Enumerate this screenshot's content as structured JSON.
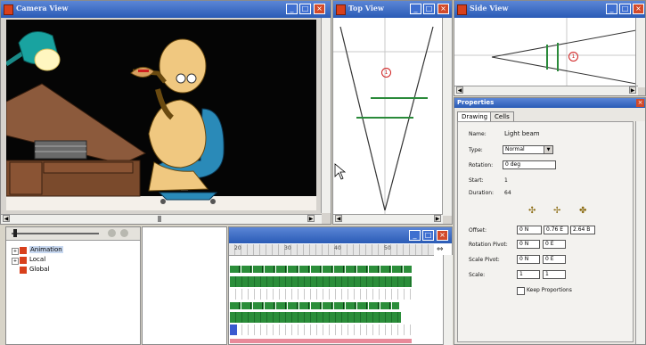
{
  "camera_view": {
    "title": "Camera View"
  },
  "top_view": {
    "title": "Top View",
    "marker": "1"
  },
  "side_view": {
    "title": "Side View",
    "marker": "1"
  },
  "properties": {
    "title": "Properties",
    "tabs": [
      "Drawing",
      "Cells"
    ],
    "active_tab": "Drawing",
    "fields": {
      "name_label": "Name:",
      "name_value": "Light beam",
      "type_label": "Type:",
      "type_value": "Normal",
      "rotation_label": "Rotation:",
      "rotation_value": "0 deg",
      "start_label": "Start:",
      "start_value": "1",
      "duration_label": "Duration:",
      "duration_value": "64",
      "offset_label": "Offset:",
      "offset_x": "0 N",
      "offset_y": "0.76 E",
      "offset_z": "2.64 B",
      "rotation_pivot_label": "Rotation Pivot:",
      "rotation_pivot_a": "0 N",
      "rotation_pivot_b": "0 E",
      "scale_pivot_label": "Scale Pivot:",
      "scale_pivot_a": "0 N",
      "scale_pivot_b": "0 E",
      "scale_label": "Scale:",
      "scale_a": "1",
      "scale_b": "1",
      "keep_proportions_label": "Keep Proportions"
    }
  },
  "layer_tree": {
    "items": [
      {
        "label": "Animation",
        "selected": true
      },
      {
        "label": "Local",
        "selected": false
      },
      {
        "label": "Global",
        "selected": false
      }
    ]
  },
  "timeline": {
    "ruler_labels": [
      "20",
      "30",
      "40",
      "50"
    ]
  },
  "colors": {
    "title_bar": "#2a5bb6",
    "track_green": "#2b8e3a",
    "close_button": "#d24a2a"
  }
}
